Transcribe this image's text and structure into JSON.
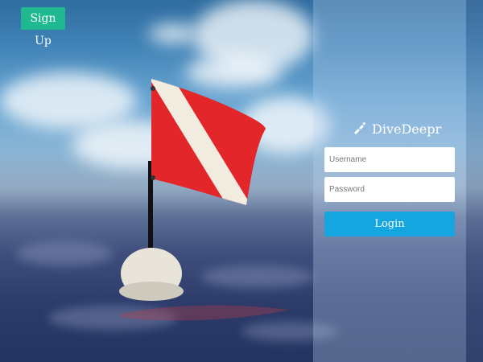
{
  "header": {
    "signup_label": "Sign Up"
  },
  "brand": {
    "name": "DiveDeepr",
    "icon": "diver-fins-icon"
  },
  "login_form": {
    "username_placeholder": "Username",
    "password_placeholder": "Password",
    "username_value": "",
    "password_value": "",
    "login_label": "Login"
  },
  "colors": {
    "signup_button": "#1fb890",
    "login_button": "#16a6df",
    "flag_red": "#e3262a",
    "flag_stripe": "#f2ece0"
  }
}
